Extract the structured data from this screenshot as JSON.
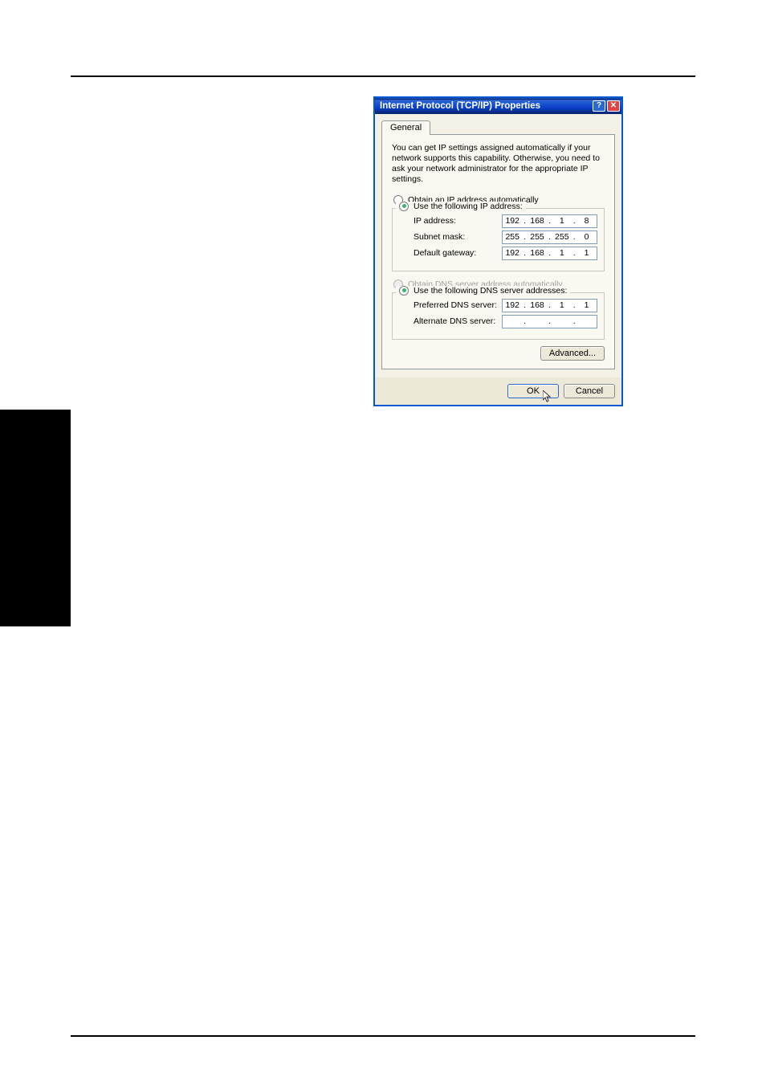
{
  "dialog": {
    "title": "Internet Protocol (TCP/IP) Properties",
    "tab": "General",
    "description": "You can get IP settings assigned automatically if your network supports this capability. Otherwise, you need to ask your network administrator for the appropriate IP settings.",
    "ip_auto_label": "Obtain an IP address automatically",
    "ip_manual_label": "Use the following IP address:",
    "ip_address_label": "IP address:",
    "subnet_label": "Subnet mask:",
    "gateway_label": "Default gateway:",
    "ip_address": {
      "o1": "192",
      "o2": "168",
      "o3": "1",
      "o4": "8"
    },
    "subnet": {
      "o1": "255",
      "o2": "255",
      "o3": "255",
      "o4": "0"
    },
    "gateway": {
      "o1": "192",
      "o2": "168",
      "o3": "1",
      "o4": "1"
    },
    "dns_auto_label": "Obtain DNS server address automatically",
    "dns_manual_label": "Use the following DNS server addresses:",
    "preferred_dns_label": "Preferred DNS server:",
    "alternate_dns_label": "Alternate DNS server:",
    "preferred_dns": {
      "o1": "192",
      "o2": "168",
      "o3": "1",
      "o4": "1"
    },
    "alternate_dns": {
      "o1": "",
      "o2": "",
      "o3": "",
      "o4": ""
    },
    "advanced_label": "Advanced...",
    "ok_label": "OK",
    "cancel_label": "Cancel"
  }
}
